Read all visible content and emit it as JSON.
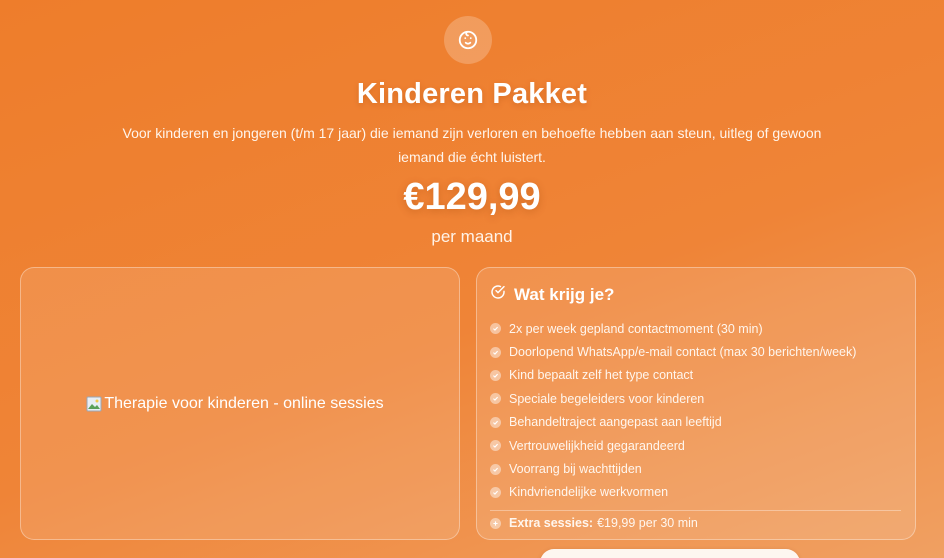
{
  "header": {
    "icon": "baby-face-icon",
    "title": "Kinderen Pakket",
    "subtitle": "Voor kinderen en jongeren (t/m 17 jaar) die iemand zijn verloren en behoefte hebben aan steun, uitleg of gewoon iemand die écht luistert.",
    "price": "€129,99",
    "period": "per maand"
  },
  "image": {
    "alt": "Therapie voor kinderen - online sessies"
  },
  "features": {
    "title": "Wat krijg je?",
    "items": [
      "2x per week gepland contactmoment (30 min)",
      "Doorlopend WhatsApp/e-mail contact (max 30 berichten/week)",
      "Kind bepaalt zelf het type contact",
      "Speciale begeleiders voor kinderen",
      "Behandeltraject aangepast aan leeftijd",
      "Vertrouwelijkheid gegarandeerd",
      "Voorrang bij wachttijden",
      "Kindvriendelijke werkvormen"
    ],
    "extra_label": "Extra sessies:",
    "extra_value": "€19,99 per 30 min"
  },
  "colors": {
    "background": "#ef8437",
    "text": "#ffffff"
  }
}
